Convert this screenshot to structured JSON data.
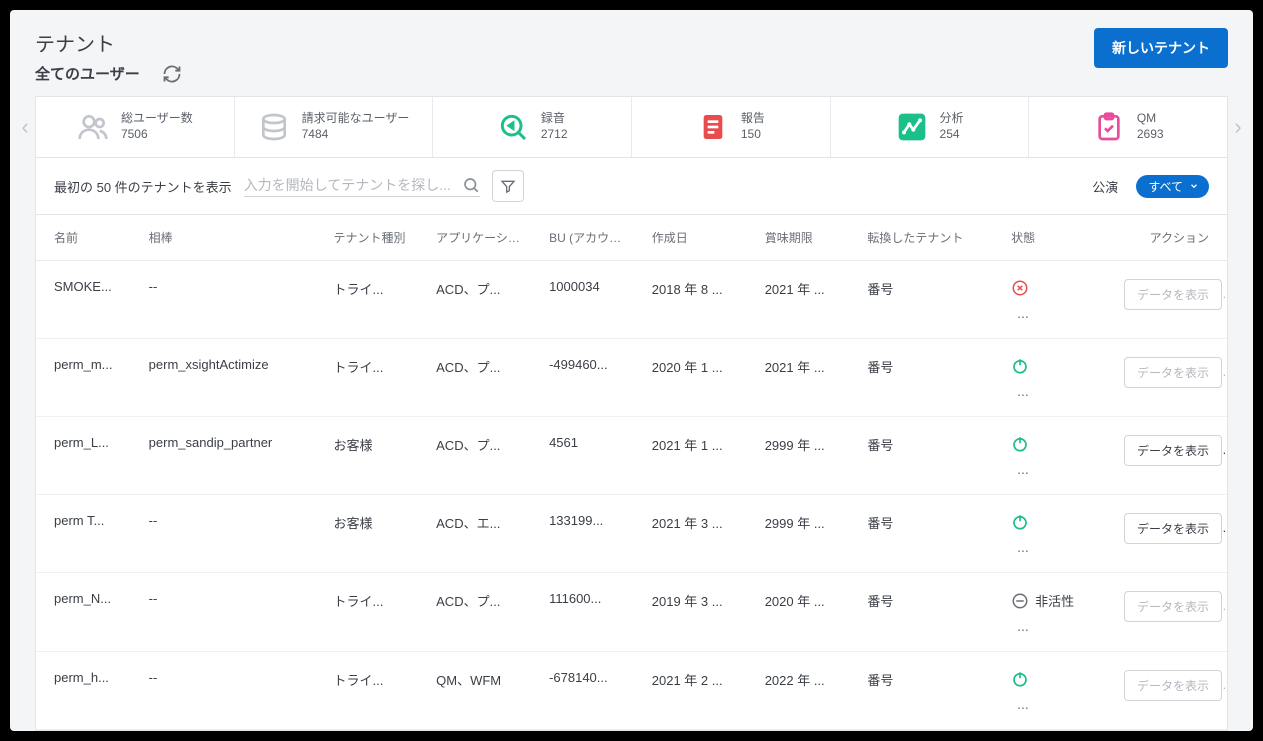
{
  "header": {
    "title": "テナント",
    "subtitle": "全てのユーザー",
    "new_button": "新しいテナント"
  },
  "stats": [
    {
      "label": "総ユーザー数",
      "value": "7506",
      "icon": "users"
    },
    {
      "label": "請求可能なユーザー",
      "value": "7484",
      "icon": "billing"
    },
    {
      "label": "録音",
      "value": "2712",
      "icon": "recording"
    },
    {
      "label": "報告",
      "value": "150",
      "icon": "report"
    },
    {
      "label": "分析",
      "value": "254",
      "icon": "analytics"
    },
    {
      "label": "QM",
      "value": "2693",
      "icon": "qm"
    }
  ],
  "toolbar": {
    "list_label": "最初の 50 件のテナントを表示",
    "search_placeholder": "入力を開始してテナントを探し...",
    "show_label": "公演",
    "show_value": "すべて"
  },
  "columns": [
    "名前",
    "相棒",
    "テナント種別",
    "アプリケーション",
    "BU (アカウント番",
    "作成日",
    "賞味期限",
    "転換したテナント",
    "状態",
    "アクション"
  ],
  "action_label": "データを表示",
  "status_text_inactive": "非活性",
  "rows": [
    {
      "name": "SMOKE...",
      "partner": "--",
      "type": "トライ...",
      "app": "ACD、プ...",
      "bu": "1000034",
      "created": "2018 年 8 ...",
      "expires": "2021 年 ...",
      "converted": "番号",
      "status": "error",
      "status_text": "",
      "action_enabled": false
    },
    {
      "name": "perm_m...",
      "partner": "perm_xsightActimize",
      "type": "トライ...",
      "app": "ACD、プ...",
      "bu": "-499460...",
      "created": "2020 年 1 ...",
      "expires": "2021 年 ...",
      "converted": "番号",
      "status": "on",
      "status_text": "",
      "action_enabled": false
    },
    {
      "name": "perm_L...",
      "partner": "perm_sandip_partner",
      "type": "お客様",
      "app": "ACD、プ...",
      "bu": "4561",
      "created": "2021 年 1 ...",
      "expires": "2999 年 ...",
      "converted": "番号",
      "status": "on",
      "status_text": "",
      "action_enabled": true
    },
    {
      "name": "perm T...",
      "partner": "--",
      "type": "お客様",
      "app": "ACD、エ...",
      "bu": "133199...",
      "created": "2021 年 3 ...",
      "expires": "2999 年 ...",
      "converted": "番号",
      "status": "on",
      "status_text": "",
      "action_enabled": true
    },
    {
      "name": "perm_N...",
      "partner": "--",
      "type": "トライ...",
      "app": "ACD、プ...",
      "bu": "111600...",
      "created": "2019 年 3 ...",
      "expires": "2020 年 ...",
      "converted": "番号",
      "status": "inactive",
      "status_text": "非活性",
      "action_enabled": false
    },
    {
      "name": "perm_h...",
      "partner": "--",
      "type": "トライ...",
      "app": "QM、WFM",
      "bu": "-678140...",
      "created": "2021 年 2 ...",
      "expires": "2022 年 ...",
      "converted": "番号",
      "status": "on",
      "status_text": "",
      "action_enabled": false
    }
  ]
}
